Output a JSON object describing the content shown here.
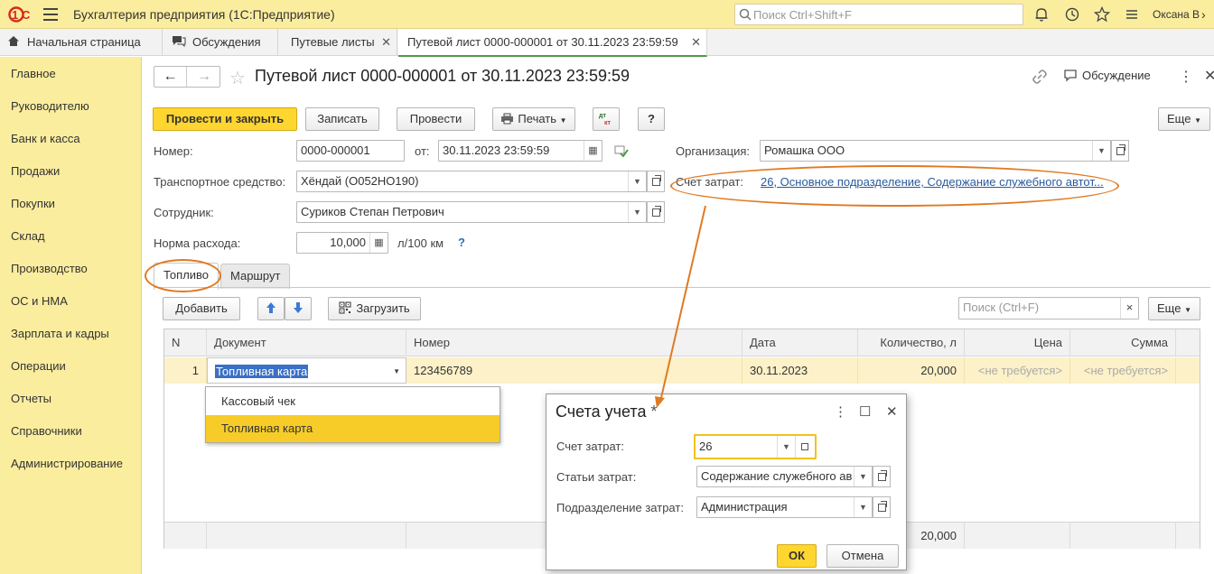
{
  "topbar": {
    "app_title": "Бухгалтерия предприятия  (1С:Предприятие)",
    "search_placeholder": "Поиск Ctrl+Shift+F",
    "user": "Оксана В",
    "more": "›"
  },
  "tabs": [
    {
      "label": "Начальная страница"
    },
    {
      "label": "Обсуждения"
    },
    {
      "label": "Путевые листы"
    },
    {
      "label": "Путевой лист 0000-000001 от 30.11.2023 23:59:59"
    }
  ],
  "sidebar": {
    "items": [
      {
        "label": "Главное"
      },
      {
        "label": "Руководителю"
      },
      {
        "label": "Банк и касса"
      },
      {
        "label": "Продажи"
      },
      {
        "label": "Покупки"
      },
      {
        "label": "Склад"
      },
      {
        "label": "Производство"
      },
      {
        "label": "ОС и НМА"
      },
      {
        "label": "Зарплата и кадры"
      },
      {
        "label": "Операции"
      },
      {
        "label": "Отчеты"
      },
      {
        "label": "Справочники"
      },
      {
        "label": "Администрирование"
      }
    ]
  },
  "doc": {
    "title": "Путевой лист 0000-000001 от 30.11.2023 23:59:59",
    "discussion": "Обсуждение",
    "toolbar": {
      "post_close": "Провести и закрыть",
      "save": "Записать",
      "post": "Провести",
      "print": "Печать",
      "help": "?",
      "more": "Еще"
    },
    "form": {
      "number_label": "Номер:",
      "number": "0000-000001",
      "from_label": "от:",
      "date": "30.11.2023 23:59:59",
      "org_label": "Организация:",
      "org": "Ромашка ООО",
      "vehicle_label": "Транспортное средство:",
      "vehicle": "Хёндай  (О052НО190)",
      "cost_account_label": "Счет затрат:",
      "cost_account_link": "26, Основное подразделение, Содержание служебного автот...",
      "employee_label": "Сотрудник:",
      "employee": "Суриков Степан Петрович",
      "rate_label": "Норма расхода:",
      "rate": "10,000",
      "rate_unit": "л/100 км",
      "rate_hint": "?"
    },
    "form_tabs": [
      {
        "label": "Топливо"
      },
      {
        "label": "Маршрут"
      }
    ],
    "table_toolbar": {
      "add": "Добавить",
      "load": "Загрузить",
      "search_placeholder": "Поиск (Ctrl+F)",
      "clear": "×",
      "more": "Еще"
    },
    "table": {
      "columns": [
        "N",
        "Документ",
        "Номер",
        "Дата",
        "Количество, л",
        "Цена",
        "Сумма"
      ],
      "rows": [
        {
          "n": "1",
          "document": "Топливная карта",
          "number": "123456789",
          "date": "30.11.2023",
          "qty": "20,000",
          "price": "<не требуется>",
          "sum": "<не требуется>"
        }
      ],
      "total_qty": "20,000"
    },
    "doc_type_options": [
      "Кассовый чек",
      "Топливная карта"
    ]
  },
  "dialog": {
    "title": "Счета учета",
    "modified_mark": "*",
    "cost_account_label": "Счет затрат:",
    "cost_account": "26",
    "cost_items_label": "Статьи затрат:",
    "cost_items": "Содержание служебного ав",
    "division_label": "Подразделение затрат:",
    "division": "Администрация",
    "ok": "ОК",
    "cancel": "Отмена"
  },
  "colors": {
    "brand_yellow": "#fbed9e",
    "primary_button": "#ffd62f",
    "selection": "#f7cc28",
    "annotation": "#e07a22",
    "link": "#2a5a9c"
  }
}
